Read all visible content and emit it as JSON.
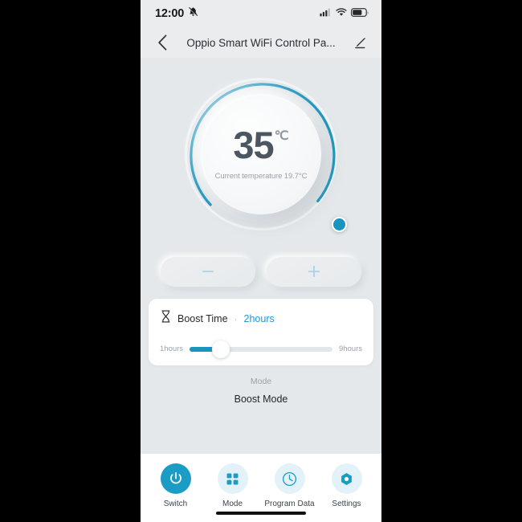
{
  "status_bar": {
    "time": "12:00",
    "mute_icon": "bell-muted-icon",
    "signal_icon": "cellular-signal-icon",
    "wifi_icon": "wifi-icon",
    "battery_icon": "battery-icon",
    "battery_level_pct": 62
  },
  "header": {
    "back_icon": "chevron-left-icon",
    "title": "Oppio Smart WiFi Control Pa...",
    "edit_icon": "pencil-edit-icon"
  },
  "dial": {
    "target_temperature": "35",
    "unit": "℃",
    "current_temperature_text": "Current temperature 19.7°C",
    "arc_color": "#1b94bd",
    "track_color": "#dfe3e6",
    "knob_icon": "dial-knob-handle",
    "arc_start_deg": 135,
    "arc_end_deg": 405,
    "value_deg": 396
  },
  "stepper": {
    "minus_label": "−",
    "minus_icon": "minus-icon",
    "plus_label": "+",
    "plus_icon": "plus-icon",
    "icon_color": "#a7d4e6"
  },
  "boost_card": {
    "hourglass_icon": "hourglass-icon",
    "title": "Boost Time",
    "separator": "·",
    "value": "2hours",
    "value_color": "#2196d4",
    "slider": {
      "min_label": "1hours",
      "max_label": "9hours",
      "min": 1,
      "max": 9,
      "value": 2,
      "fill_pct": 22,
      "fill_color": "#1b94bd",
      "track_color": "#e3e7ea"
    }
  },
  "mode_section": {
    "label": "Mode",
    "value": "Boost Mode"
  },
  "bottom_nav": {
    "items": [
      {
        "label": "Switch",
        "icon": "power-icon",
        "active": true
      },
      {
        "label": "Mode",
        "icon": "grid-squares-icon",
        "active": false
      },
      {
        "label": "Program Data",
        "icon": "clock-icon",
        "active": false
      },
      {
        "label": "Settings",
        "icon": "hexagon-gear-icon",
        "active": false
      }
    ],
    "active_bg": "#1b9cc4",
    "inactive_bg": "#e2f2f8",
    "icon_color": "#1b9cc4"
  },
  "home_indicator": "home-indicator-bar"
}
